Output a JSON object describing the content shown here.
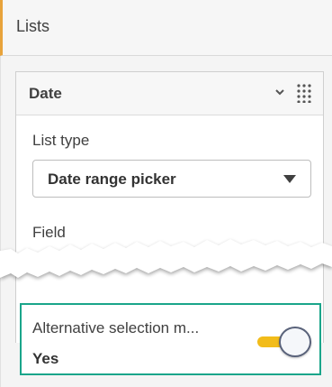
{
  "section": {
    "title": "Lists",
    "accent_color": "#e8a33b"
  },
  "card": {
    "title": "Date",
    "list_type": {
      "label": "List type",
      "selected": "Date range picker"
    },
    "field": {
      "label": "Field"
    }
  },
  "alternative_selection": {
    "label": "Alternative selection m...",
    "value": "Yes",
    "toggle_on": true,
    "highlight_color": "#1aa58a",
    "toggle_color": "#f2bc1a"
  }
}
